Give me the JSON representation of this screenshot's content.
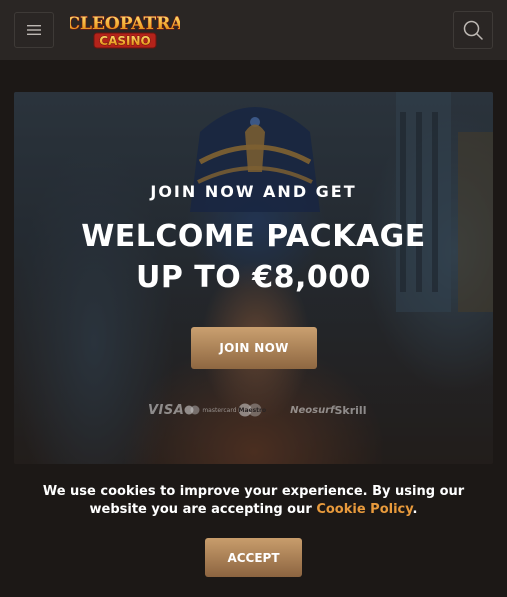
{
  "header": {
    "menu_icon": "hamburger-icon",
    "search_icon": "search-icon",
    "logo": {
      "line1": "CLEOPATRA",
      "line2": "CASINO"
    }
  },
  "hero": {
    "kicker": "JOIN NOW AND GET",
    "title_line1": "WELCOME PACKAGE",
    "title_line2": "UP TO €8,000",
    "cta_label": "JOIN NOW",
    "payments": {
      "visa": "VISA",
      "mastercard": "mastercard",
      "maestro": "Maestro",
      "neosurf": "Neosurf",
      "skrill": "Skrill"
    }
  },
  "cookie": {
    "text_before": "We use cookies to improve your experience. By using our website you are accepting our ",
    "link": "Cookie Policy",
    "text_after": ".",
    "accept_label": "ACCEPT"
  },
  "colors": {
    "background": "#1c1816",
    "header": "#2a2624",
    "accent_gold": "#b8895a",
    "link_orange": "#e89a3c"
  }
}
